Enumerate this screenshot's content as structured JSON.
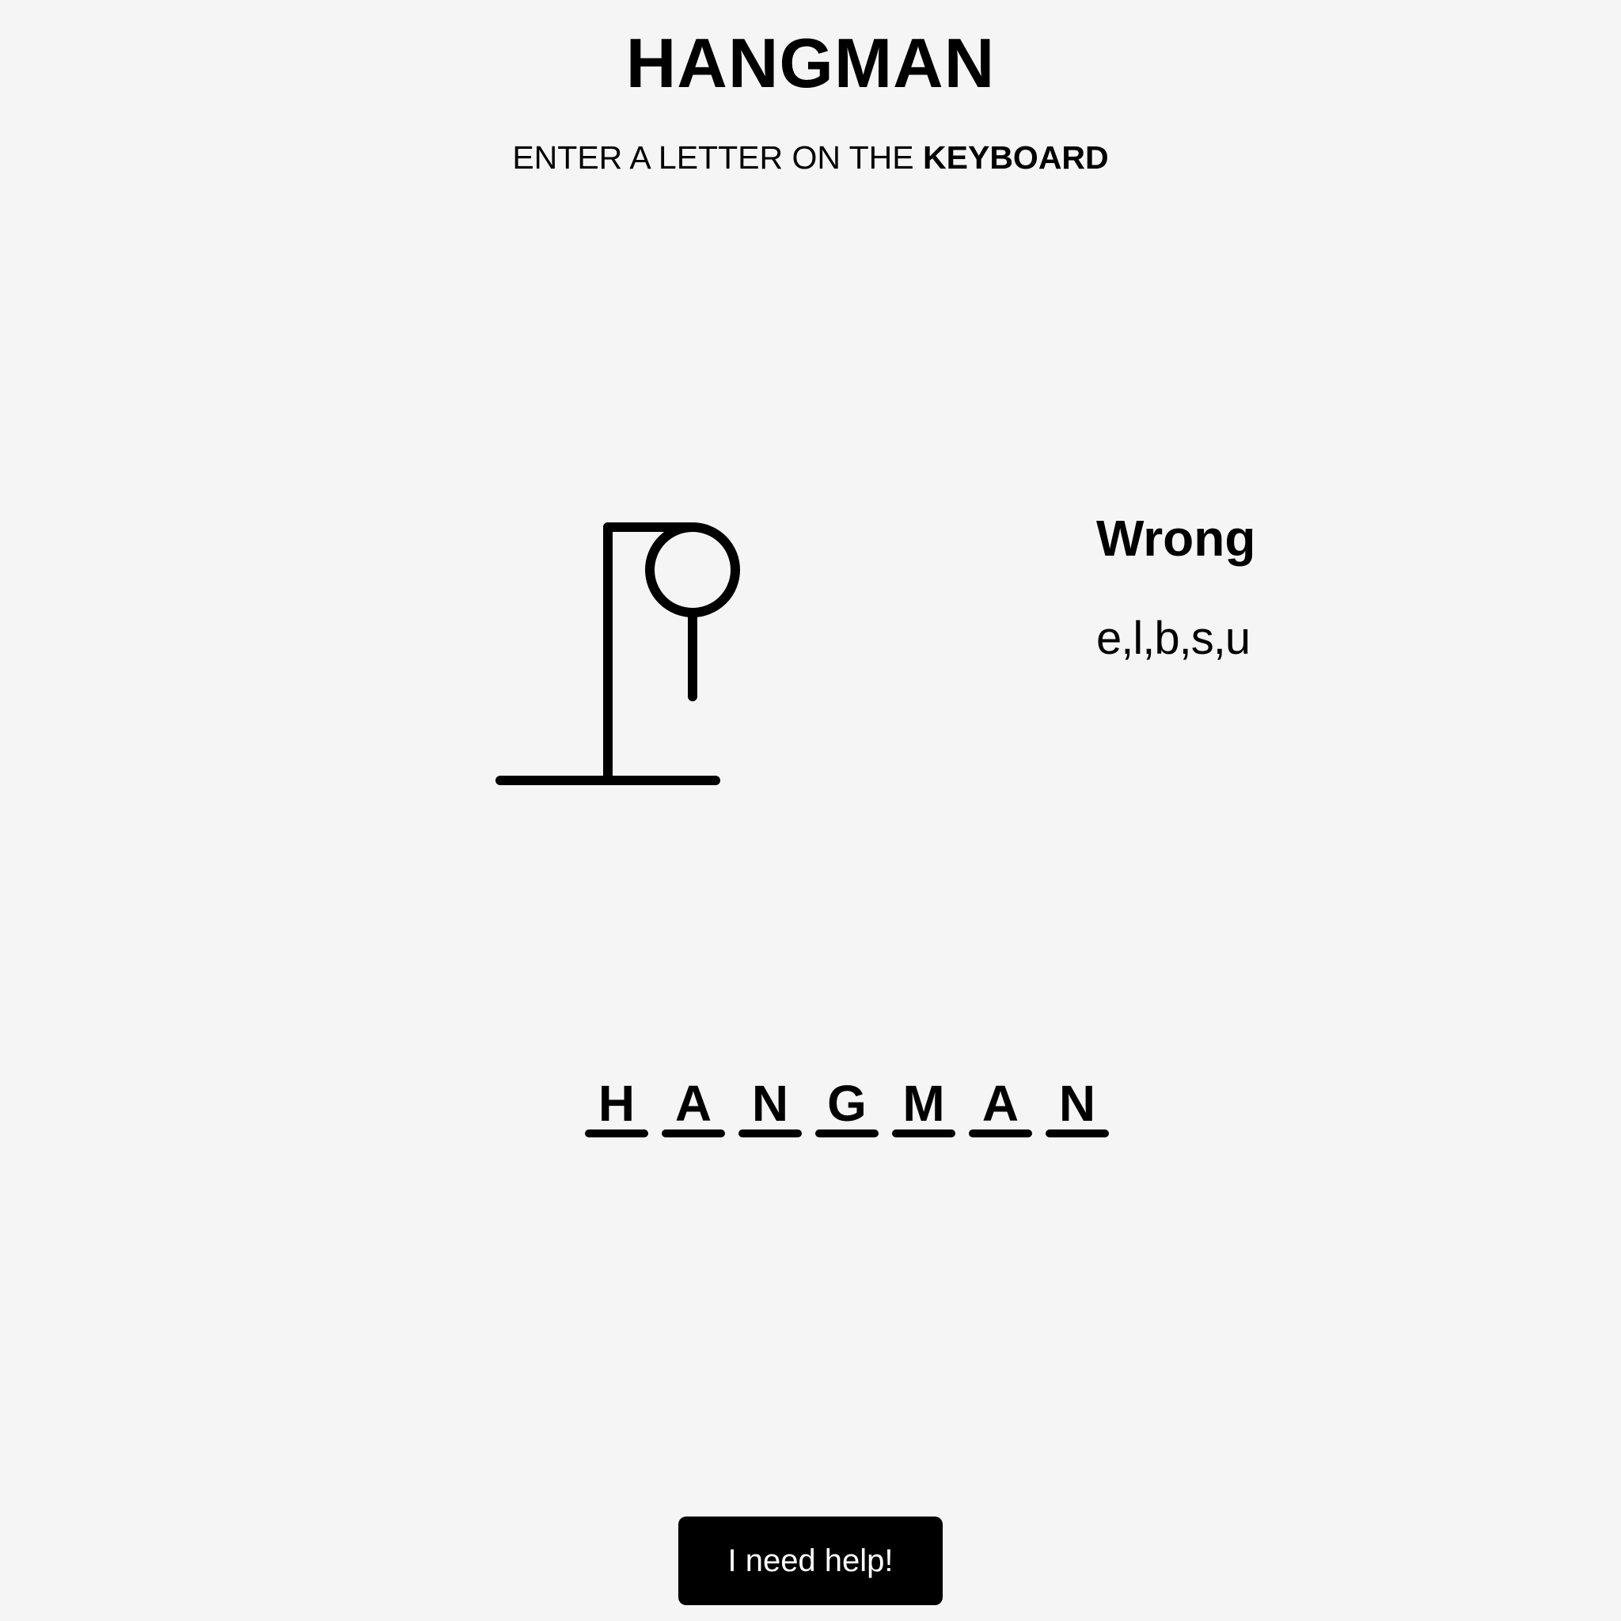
{
  "header": {
    "title": "HANGMAN",
    "instruction_prefix": "ENTER A LETTER ON THE ",
    "instruction_bold": "KEYBOARD"
  },
  "game": {
    "wrong_label": "Wrong",
    "wrong_letters": "e,l,b,s,u",
    "word": [
      "H",
      "A",
      "N",
      "G",
      "M",
      "A",
      "N"
    ],
    "figure_parts_shown": [
      "head",
      "body"
    ]
  },
  "help": {
    "button_label": "I need help!"
  }
}
